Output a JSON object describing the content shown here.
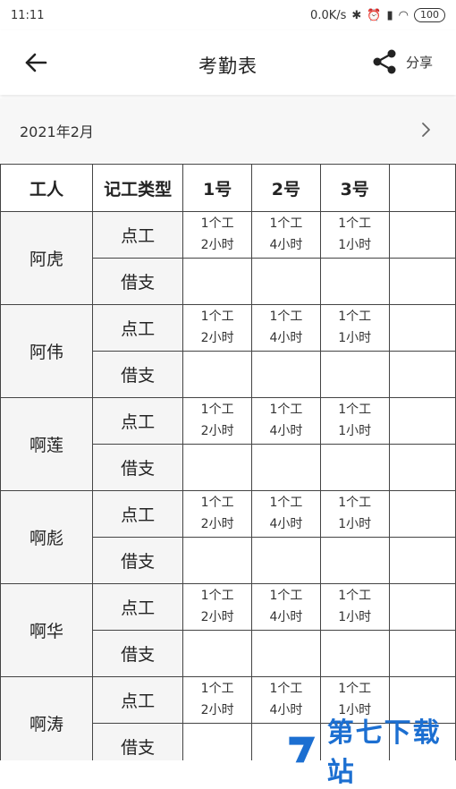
{
  "status": {
    "time": "11:11",
    "speed": "0.0K/s",
    "battery": "100"
  },
  "appbar": {
    "title": "考勤表",
    "share_label": "分享"
  },
  "month": {
    "label": "2021年2月"
  },
  "table": {
    "headers": [
      "工人",
      "记工类型",
      "1号",
      "2号",
      "3号"
    ],
    "rows": [
      {
        "name": "阿虎",
        "type1": "点工",
        "type2": "借支",
        "d1": {
          "l1": "1个工",
          "l2": "2小时"
        },
        "d2": {
          "l1": "1个工",
          "l2": "4小时"
        },
        "d3": {
          "l1": "1个工",
          "l2": "1小时"
        }
      },
      {
        "name": "阿伟",
        "type1": "点工",
        "type2": "借支",
        "d1": {
          "l1": "1个工",
          "l2": "2小时"
        },
        "d2": {
          "l1": "1个工",
          "l2": "4小时"
        },
        "d3": {
          "l1": "1个工",
          "l2": "1小时"
        }
      },
      {
        "name": "啊莲",
        "type1": "点工",
        "type2": "借支",
        "d1": {
          "l1": "1个工",
          "l2": "2小时"
        },
        "d2": {
          "l1": "1个工",
          "l2": "4小时"
        },
        "d3": {
          "l1": "1个工",
          "l2": "1小时"
        }
      },
      {
        "name": "啊彪",
        "type1": "点工",
        "type2": "借支",
        "d1": {
          "l1": "1个工",
          "l2": "2小时"
        },
        "d2": {
          "l1": "1个工",
          "l2": "4小时"
        },
        "d3": {
          "l1": "1个工",
          "l2": "1小时"
        }
      },
      {
        "name": "啊华",
        "type1": "点工",
        "type2": "借支",
        "d1": {
          "l1": "1个工",
          "l2": "2小时"
        },
        "d2": {
          "l1": "1个工",
          "l2": "4小时"
        },
        "d3": {
          "l1": "1个工",
          "l2": "1小时"
        }
      },
      {
        "name": "啊涛",
        "type1": "点工",
        "type2": "借支",
        "d1": {
          "l1": "1个工",
          "l2": "2小时"
        },
        "d2": {
          "l1": "1个工",
          "l2": "4小时"
        },
        "d3": {
          "l1": "1个工",
          "l2": "1小时"
        }
      }
    ]
  },
  "watermark": {
    "text": "第七下载站",
    "url": "www.d7down.com"
  },
  "colors": {
    "border": "#444444",
    "header_bg": "#ffffff",
    "label_bg": "#f5f5f5",
    "watermark": "#1c6fd1"
  },
  "icons": {
    "back": "arrow-left-icon",
    "share": "share-icon",
    "next": "chevron-right-icon"
  }
}
